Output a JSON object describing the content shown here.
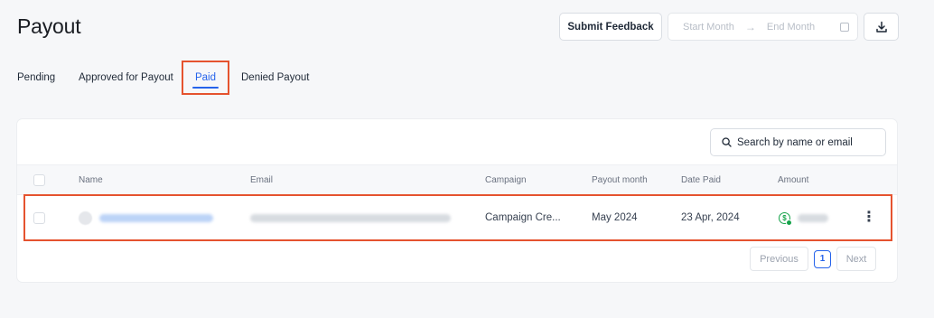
{
  "page": {
    "title": "Payout"
  },
  "toolbar": {
    "feedback_label": "Submit Feedback",
    "date_start_placeholder": "Start Month",
    "date_arrow": "→",
    "date_end_placeholder": "End Month"
  },
  "tabs": [
    {
      "label": "Pending",
      "active": false
    },
    {
      "label": "Approved for Payout",
      "active": false
    },
    {
      "label": "Paid",
      "active": true
    },
    {
      "label": "Denied Payout",
      "active": false
    }
  ],
  "search": {
    "placeholder": "Search by name or email"
  },
  "table": {
    "columns": [
      "Name",
      "Email",
      "Campaign",
      "Payout month",
      "Date Paid",
      "Amount"
    ],
    "rows": [
      {
        "campaign": "Campaign Cre...",
        "payout_month": "May 2024",
        "date_paid": "23 Apr, 2024"
      }
    ]
  },
  "pagination": {
    "previous": "Previous",
    "current": "1",
    "next": "Next"
  },
  "colors": {
    "accent": "#2563eb",
    "highlight": "#e5532f",
    "paid_icon": "#16a34a"
  }
}
